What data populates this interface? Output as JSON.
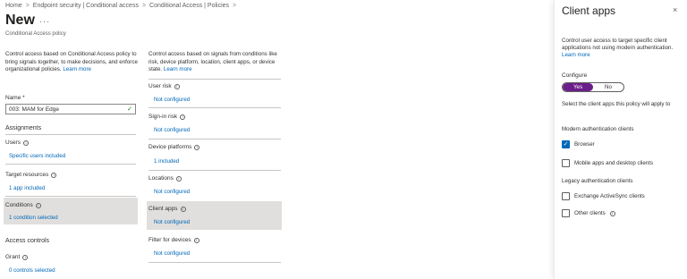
{
  "breadcrumb": [
    "Home",
    "Endpoint security | Conditional access",
    "Conditional Access | Policies"
  ],
  "page": {
    "title": "New",
    "more": "···",
    "subtitle": "Conditional Access policy"
  },
  "left": {
    "description": "Control access based on Conditional Access policy to bring signals together, to make decisions, and enforce organizational policies.",
    "learn_more": "Learn more",
    "name_label": "Name *",
    "name_value": "003: MAM for Edge",
    "assignments_heading": "Assignments",
    "users_label": "Users",
    "users_value": "Specific users included",
    "target_label": "Target resources",
    "target_value": "1 app included",
    "conditions_label": "Conditions",
    "conditions_value": "1 condition selected",
    "access_heading": "Access controls",
    "grant_label": "Grant",
    "grant_value": "0 controls selected"
  },
  "middle": {
    "description": "Control access based on signals from conditions like risk, device platform, location, client apps, or device state.",
    "learn_more": "Learn more",
    "items": [
      {
        "label": "User risk",
        "value": "Not configured"
      },
      {
        "label": "Sign-in risk",
        "value": "Not configured"
      },
      {
        "label": "Device platforms",
        "value": "1 included"
      },
      {
        "label": "Locations",
        "value": "Not configured"
      },
      {
        "label": "Client apps",
        "value": "Not configured"
      },
      {
        "label": "Filter for devices",
        "value": "Not configured"
      }
    ]
  },
  "panel": {
    "title": "Client apps",
    "close": "×",
    "description": "Control user access to target specific client applications not using modern authentication.",
    "learn_more": "Learn more",
    "configure_label": "Configure",
    "toggle_yes": "Yes",
    "toggle_no": "No",
    "select_text": "Select the client apps this policy will apply to",
    "modern_heading": "Modern authentication clients",
    "browser_label": "Browser",
    "mobile_label": "Mobile apps and desktop clients",
    "legacy_heading": "Legacy authentication clients",
    "exchange_label": "Exchange ActiveSync clients",
    "other_label": "Other clients"
  },
  "colors": {
    "accent": "#0067b8",
    "toggle_on": "#6b1f8a",
    "highlight": "#e1dfdd"
  }
}
